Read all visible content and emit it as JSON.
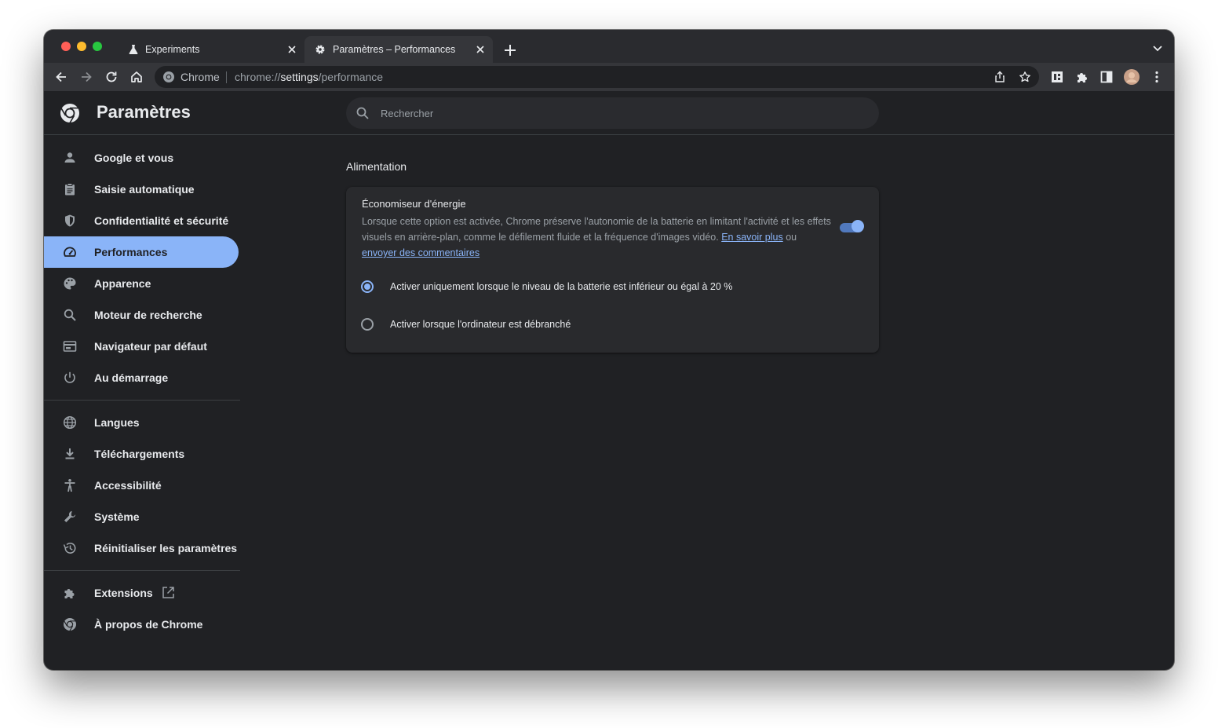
{
  "colors": {
    "window_bg": "#202124",
    "tabstrip_bg": "#2a2b2f",
    "toolbar_bg": "#35363a",
    "accent": "#8ab4f8",
    "text_primary": "#e8eaed",
    "text_secondary": "#9aa0a6",
    "traffic_close": "#ff5f57",
    "traffic_minimize": "#febc2e",
    "traffic_zoom": "#28c840"
  },
  "tabs": [
    {
      "title": "Experiments",
      "icon": "flask-icon",
      "active": false
    },
    {
      "title": "Paramètres – Performances",
      "icon": "gear-icon",
      "active": true
    }
  ],
  "omnibox": {
    "site_chip": "Chrome",
    "url_scheme": "chrome://",
    "url_host": "settings",
    "url_path": "/performance"
  },
  "header": {
    "title": "Paramètres",
    "search_placeholder": "Rechercher"
  },
  "sidebar": {
    "items": [
      {
        "label": "Google et vous",
        "icon": "person-icon"
      },
      {
        "label": "Saisie automatique",
        "icon": "clipboard-icon"
      },
      {
        "label": "Confidentialité et sécurité",
        "icon": "shield-icon"
      },
      {
        "label": "Performances",
        "icon": "speedometer-icon",
        "selected": true
      },
      {
        "label": "Apparence",
        "icon": "palette-icon"
      },
      {
        "label": "Moteur de recherche",
        "icon": "search-icon"
      },
      {
        "label": "Navigateur par défaut",
        "icon": "browser-icon"
      },
      {
        "label": "Au démarrage",
        "icon": "power-icon"
      }
    ],
    "advanced_items": [
      {
        "label": "Langues",
        "icon": "globe-icon"
      },
      {
        "label": "Téléchargements",
        "icon": "download-icon"
      },
      {
        "label": "Accessibilité",
        "icon": "accessibility-icon"
      },
      {
        "label": "Système",
        "icon": "wrench-icon"
      },
      {
        "label": "Réinitialiser les paramètres",
        "icon": "history-icon"
      }
    ],
    "footer_items": [
      {
        "label": "Extensions",
        "icon": "puzzle-icon"
      },
      {
        "label": "À propos de Chrome",
        "icon": "chrome-icon"
      }
    ]
  },
  "main": {
    "section_title": "Alimentation",
    "energy_saver": {
      "title": "Économiseur d'énergie",
      "description": "Lorsque cette option est activée, Chrome préserve l'autonomie de la batterie en limitant l'activité et les effets visuels en arrière-plan, comme le défilement fluide et la fréquence d'images vidéo.",
      "learn_more": "En savoir plus",
      "or": "ou",
      "feedback": "envoyer des commentaires",
      "enabled": true
    },
    "options": [
      {
        "label": "Activer uniquement lorsque le niveau de la batterie est inférieur ou égal à 20 %",
        "checked": true
      },
      {
        "label": "Activer lorsque l'ordinateur est débranché",
        "checked": false
      }
    ]
  }
}
